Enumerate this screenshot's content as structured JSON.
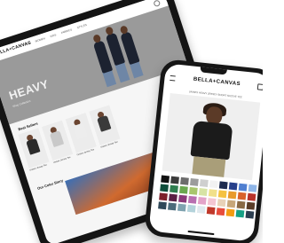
{
  "tablet": {
    "brand": "BELLA+CANVAS",
    "nav": [
      "MEN",
      "WOMEN",
      "KIDS",
      "FABRICS",
      "STYLES"
    ],
    "hero_title": "HEAVY",
    "hero_caption": "Shop Collection",
    "section_title": "Best Sellers",
    "products": [
      {
        "label": "Unisex Jersey Tee",
        "shirt_color": "#2b2b2b"
      },
      {
        "label": "Unisex Jersey Tee",
        "shirt_color": "#c9c9c9"
      },
      {
        "label": "Unisex Jersey Tee",
        "shirt_color": "#ededed"
      },
      {
        "label": "Unisex Jersey Tee",
        "shirt_color": "#3a3a3a"
      }
    ],
    "colorwave_title": "Our Color Story"
  },
  "phone": {
    "brand": "BELLA+CANVAS",
    "subtitle": "UNISEX HEAVY JERSEY SHORT SLEEVE TEE",
    "swatches": [
      "#111111",
      "#3b3b3b",
      "#6c6c6c",
      "#9c9c9c",
      "#cfcfcf",
      "#f2f2f2",
      "#1d2b4f",
      "#27408b",
      "#4f7fd1",
      "#8fb6e8",
      "#0e4d3a",
      "#2e7d4f",
      "#6aa84f",
      "#a8c66c",
      "#d7e3a4",
      "#f1e08a",
      "#f5c242",
      "#e89a2c",
      "#d9622b",
      "#b8332c",
      "#7d1f2a",
      "#5a1e44",
      "#8a3a7a",
      "#b86fb0",
      "#e3a3c8",
      "#f4c6d2",
      "#e8d2b8",
      "#c7a77a",
      "#8a6a45",
      "#5a3d28",
      "#2f4858",
      "#4b6b7a",
      "#7fa3b0",
      "#b4d3db",
      "#dfe9ee",
      "#c0392b",
      "#e74c3c",
      "#f39c12",
      "#16a085",
      "#2c3e50"
    ]
  }
}
